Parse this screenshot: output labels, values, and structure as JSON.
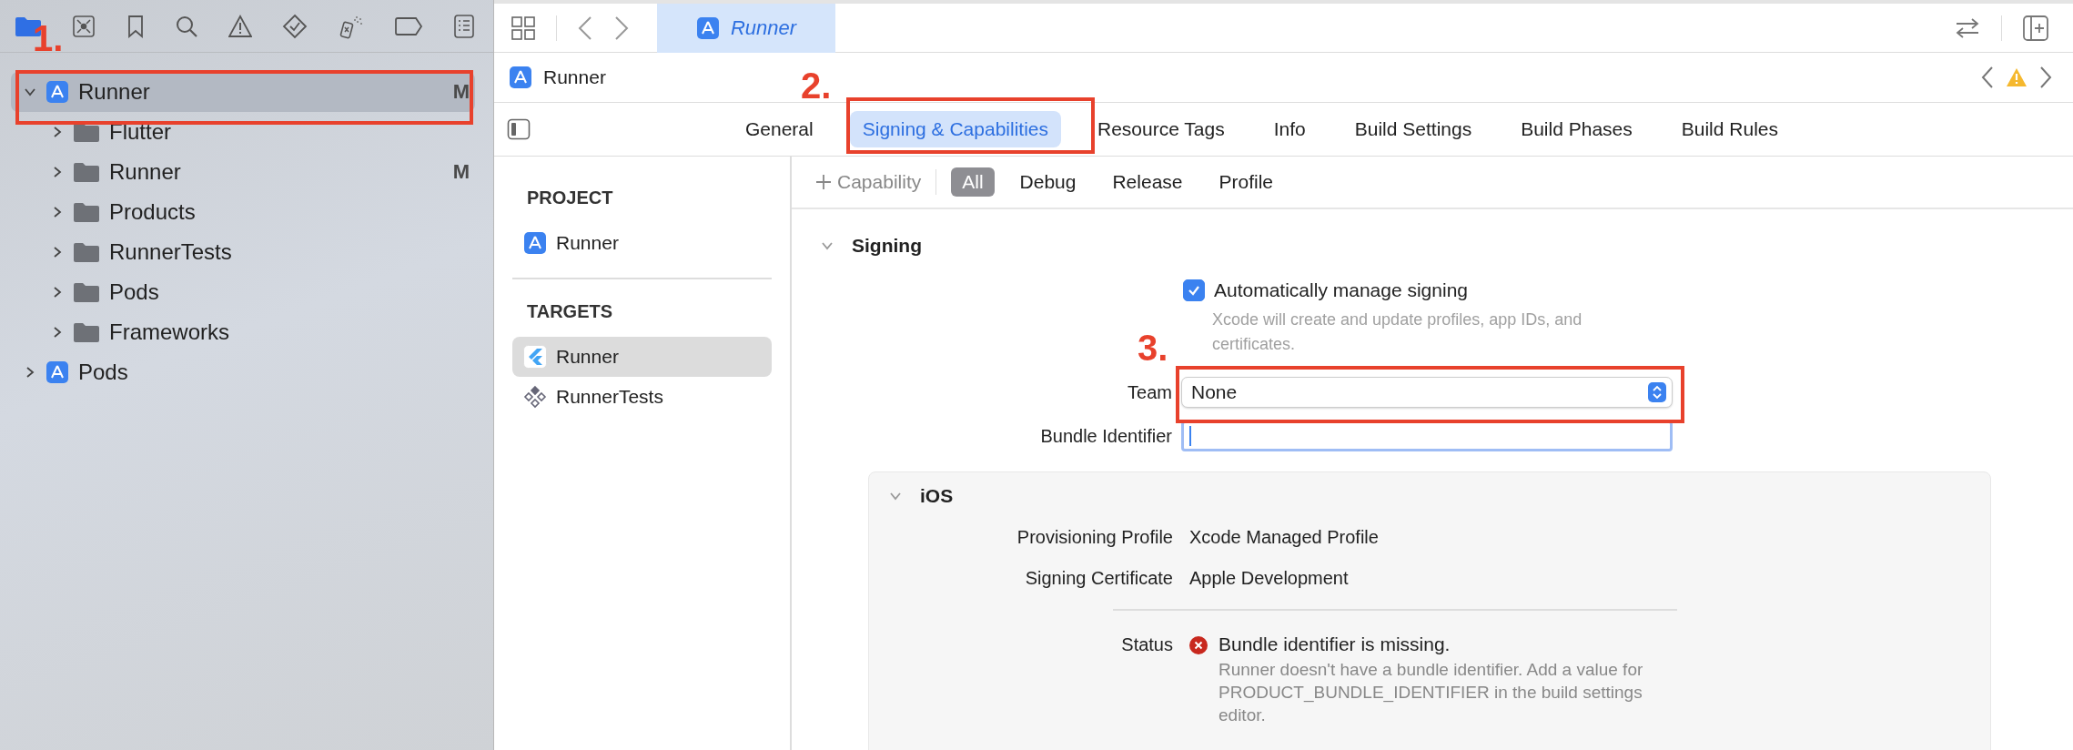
{
  "navigator": {
    "tree": [
      {
        "label": "Runner",
        "kind": "project",
        "badge": "M",
        "expanded": true,
        "selected": true,
        "children": [
          {
            "label": "Flutter",
            "kind": "folder",
            "expanded": false,
            "selected": false
          },
          {
            "label": "Runner",
            "kind": "folder",
            "badge": "M",
            "expanded": false,
            "selected": false
          },
          {
            "label": "Products",
            "kind": "folder",
            "expanded": false,
            "selected": false
          },
          {
            "label": "RunnerTests",
            "kind": "folder",
            "expanded": false,
            "selected": false
          },
          {
            "label": "Pods",
            "kind": "folder",
            "expanded": false,
            "selected": false
          },
          {
            "label": "Frameworks",
            "kind": "folder",
            "expanded": false,
            "selected": false
          }
        ]
      },
      {
        "label": "Pods",
        "kind": "project",
        "expanded": false,
        "selected": false
      }
    ]
  },
  "editor_tabs": [
    {
      "label": "Runner",
      "selected": true
    }
  ],
  "breadcrumb": "Runner",
  "settings_tabs": [
    {
      "label": "General",
      "selected": false
    },
    {
      "label": "Signing & Capabilities",
      "selected": true
    },
    {
      "label": "Resource Tags",
      "selected": false
    },
    {
      "label": "Info",
      "selected": false
    },
    {
      "label": "Build Settings",
      "selected": false
    },
    {
      "label": "Build Phases",
      "selected": false
    },
    {
      "label": "Build Rules",
      "selected": false
    }
  ],
  "targets_panel": {
    "sections": [
      {
        "title": "PROJECT",
        "items": [
          {
            "label": "Runner",
            "kind": "project",
            "selected": false
          }
        ]
      },
      {
        "title": "TARGETS",
        "items": [
          {
            "label": "Runner",
            "kind": "flutter",
            "selected": true
          },
          {
            "label": "RunnerTests",
            "kind": "tests",
            "selected": false
          }
        ]
      }
    ]
  },
  "capability_bar": {
    "add_label": "Capability",
    "filters": [
      {
        "label": "All",
        "selected": true
      },
      {
        "label": "Debug",
        "selected": false
      },
      {
        "label": "Release",
        "selected": false
      },
      {
        "label": "Profile",
        "selected": false
      }
    ]
  },
  "signing": {
    "title": "Signing",
    "expanded": true,
    "auto_manage": {
      "label": "Automatically manage signing",
      "checked": true,
      "hint": "Xcode will create and update profiles, app IDs, and certificates."
    },
    "team": {
      "label": "Team",
      "value": "None"
    },
    "bundle_identifier": {
      "label": "Bundle Identifier"
    },
    "platform": {
      "title": "iOS",
      "expanded": true,
      "rows": [
        {
          "label": "Provisioning Profile",
          "value": "Xcode Managed Profile"
        },
        {
          "label": "Signing Certificate",
          "value": "Apple Development"
        }
      ],
      "status": {
        "label": "Status",
        "message": "Bundle identifier is missing.",
        "detail": "Runner doesn't have a bundle identifier. Add a value for PRODUCT_BUNDLE_IDENTIFIER in the build settings editor."
      }
    }
  },
  "annotations": [
    {
      "label": "1."
    },
    {
      "label": "2."
    },
    {
      "label": "3."
    }
  ]
}
